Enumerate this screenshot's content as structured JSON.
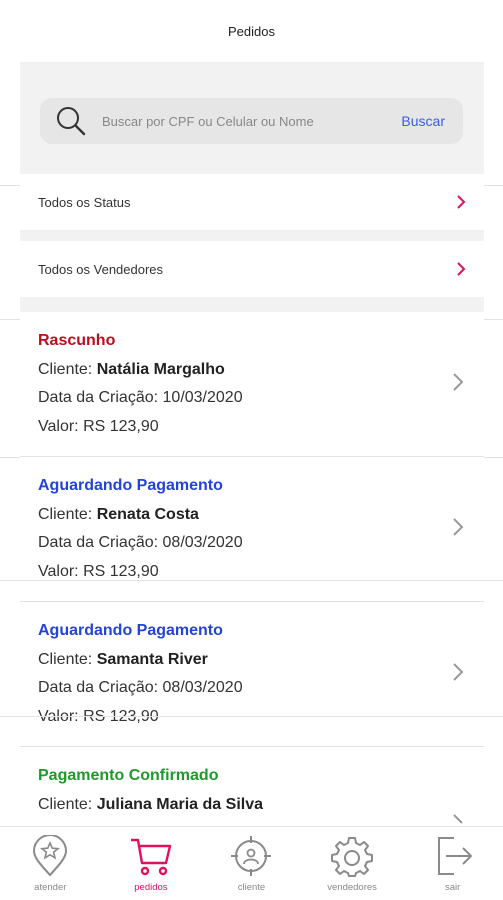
{
  "header": {
    "title": "Pedidos"
  },
  "search": {
    "placeholder": "Buscar por CPF ou Celular ou Nome",
    "button_label": "Buscar"
  },
  "filters": [
    {
      "label": "Todos os Status"
    },
    {
      "label": "Todos os Vendedores"
    }
  ],
  "orders": [
    {
      "status": "Rascunho",
      "status_color": "#b80f1f",
      "client_label": "Cliente:",
      "client": "Natália Margalho",
      "date_label": "Data da Criação:",
      "date": "10/03/2020",
      "value_label": "Valor:",
      "value": "RS 123,90"
    },
    {
      "status": "Aguardando Pagamento",
      "status_color": "#2443d8",
      "client_label": "Cliente:",
      "client": "Renata Costa",
      "date_label": "Data da Criação:",
      "date": "08/03/2020",
      "value_label": "Valor:",
      "value": "RS 123,90"
    },
    {
      "status": "Aguardando Pagamento",
      "status_color": "#2443d8",
      "client_label": "Cliente:",
      "client": "Samanta River",
      "date_label": "Data da Criação:",
      "date": "08/03/2020",
      "value_label": "Valor:",
      "value": "RS 123,90"
    },
    {
      "status": "Pagamento Confirmado",
      "status_color": "#1e9a2a",
      "client_label": "Cliente:",
      "client": "Juliana Maria da Silva"
    }
  ],
  "tabbar": {
    "items": [
      {
        "label": "atender",
        "icon": "map-pin-star-icon"
      },
      {
        "label": "pedidos",
        "icon": "cart-icon",
        "active": true
      },
      {
        "label": "cliente",
        "icon": "target-person-icon"
      },
      {
        "label": "vendedores",
        "icon": "gear-icon"
      },
      {
        "label": "sair",
        "icon": "logout-icon"
      }
    ]
  },
  "colors": {
    "accent": "#e0115f",
    "link": "#3a5ee0"
  }
}
